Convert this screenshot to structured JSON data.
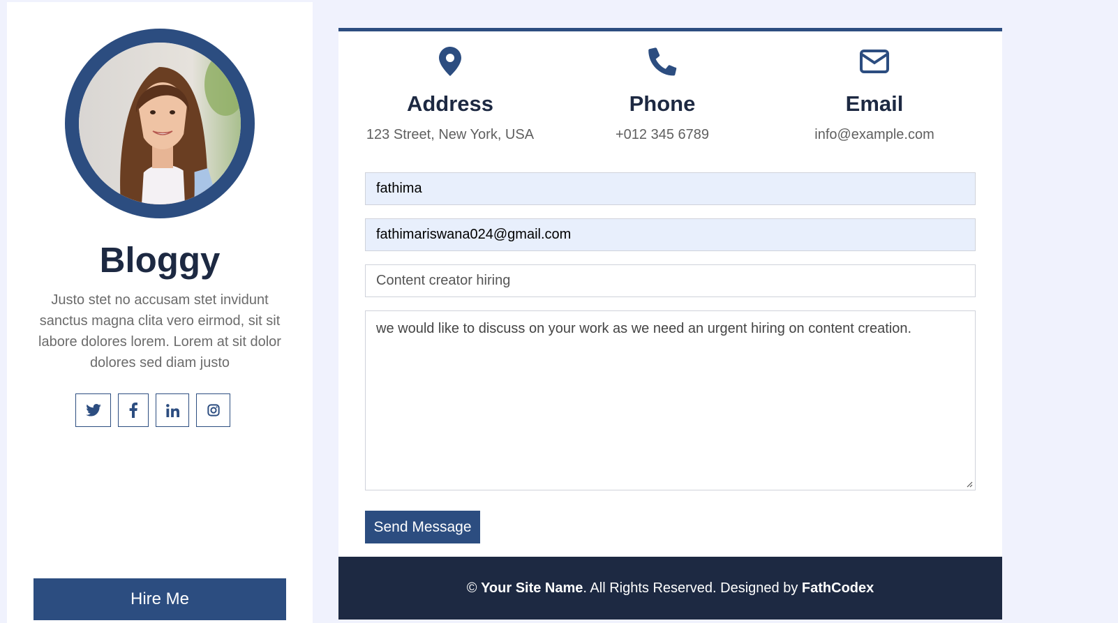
{
  "sidebar": {
    "name": "Bloggy",
    "bio": "Justo stet no accusam stet invidunt sanctus magna clita vero eirmod, sit sit labore dolores lorem. Lorem at sit dolor dolores sed diam justo",
    "social": [
      {
        "icon": "twitter-icon"
      },
      {
        "icon": "facebook-icon"
      },
      {
        "icon": "linkedin-icon"
      },
      {
        "icon": "instagram-icon"
      }
    ],
    "hire_label": "Hire Me"
  },
  "contact_info": [
    {
      "icon": "map-pin-icon",
      "title": "Address",
      "value": "123 Street, New York, USA"
    },
    {
      "icon": "phone-icon",
      "title": "Phone",
      "value": "+012 345 6789"
    },
    {
      "icon": "envelope-icon",
      "title": "Email",
      "value": "info@example.com"
    }
  ],
  "form": {
    "name_value": "fathima",
    "email_value": "fathimariswana024@gmail.com",
    "subject_value": "Content creator hiring",
    "message_value": "we would like to discuss on your work as we need an urgent hiring on content creation.",
    "send_label": "Send Message"
  },
  "footer": {
    "copyright_symbol": "©",
    "site_name": "Your Site Name",
    "rights_text": ". All Rights Reserved. Designed by",
    "designer": "FathCodex"
  },
  "colors": {
    "primary": "#2c4d80",
    "dark": "#1d2942",
    "page_bg": "#f0f2fd",
    "field_filled_bg": "#e8effc"
  }
}
